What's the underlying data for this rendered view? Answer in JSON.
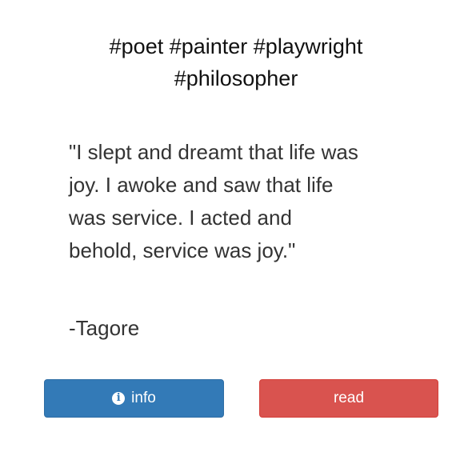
{
  "hashtags": {
    "line1": "#poet #painter #playwright",
    "line2": "#philosopher"
  },
  "quote": {
    "line1": "\"I slept and dreamt that life was",
    "line2": "joy. I awoke and saw that life",
    "line3": "was service. I acted and",
    "line4": "behold, service was joy.\"",
    "author": "-Tagore"
  },
  "buttons": {
    "info_label": "info",
    "info_icon": "info-circle-icon",
    "info_icon_glyph": "i",
    "read_label": "read",
    "info_color": "#337ab7",
    "read_color": "#d9534f"
  }
}
